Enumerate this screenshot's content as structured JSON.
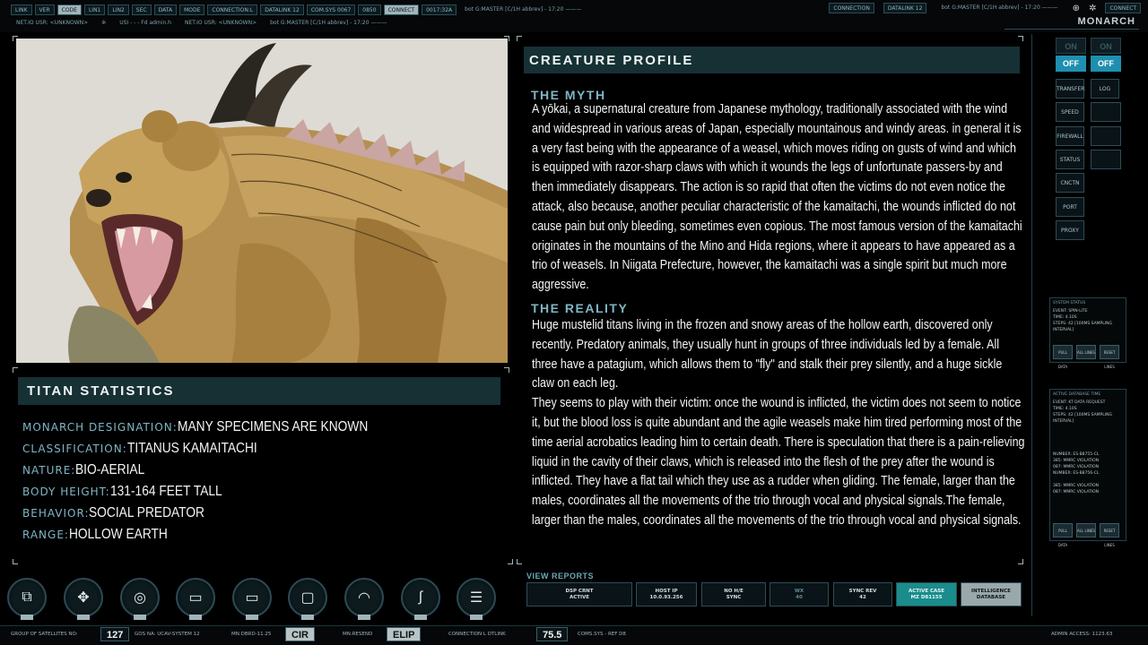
{
  "topbar": {
    "row1_buttons": [
      "LINK",
      "VER",
      "CODE",
      "LIN1",
      "LIN2",
      "SEC",
      "DATA",
      "MODE"
    ],
    "row1_texts": [
      "CONNECTION:L",
      "DATALINK 12",
      "COM.SYS 0067",
      "0850"
    ],
    "connect_label": "CONNECT",
    "code_readout": "0017:32A",
    "user_line": "bot G:MASTER [C/1H abbrev] - 17:20 ———",
    "row2_left": "NET.IO USR: <UNKNOWN>",
    "row2_mid": "USI - - - Fd admin.h",
    "row2_user": "NET.IO USR: <UNKNOWN>",
    "row2_bot": "bot G:MASTER [C/1H abbrev] - 17:20 ———",
    "right_connection": "CONNECTION",
    "right_datalink": "DATALINK 12",
    "right_user": "bot G:MASTER [C/1H abbrev] - 17:20 ———",
    "right_connect": "CONNECT",
    "brand": "MONARCH"
  },
  "stats": {
    "header": "TITAN STATISTICS",
    "rows": [
      {
        "label": "MONARCH DESIGNATION:",
        "value": "MANY SPECIMENS ARE KNOWN"
      },
      {
        "label": "CLASSIFICATION:",
        "value": "TITANUS KAMAITACHI"
      },
      {
        "label": "NATURE:",
        "value": "BIO-AERIAL"
      },
      {
        "label": "BODY HEIGHT:",
        "value": "131-164 FEET TALL"
      },
      {
        "label": "BEHAVIOR:",
        "value": "SOCIAL PREDATOR"
      },
      {
        "label": "RANGE:",
        "value": "HOLLOW EARTH"
      }
    ]
  },
  "profile": {
    "header": "CREATURE PROFILE",
    "myth_title": "THE MYTH",
    "myth_text": "A yōkai, a supernatural creature from Japanese mythology, traditionally associated with the wind and widespread in various areas of Japan, especially mountainous and windy areas. in general it is a very fast being with the appearance of a weasel, which moves riding on gusts of wind and which is equipped with razor-sharp claws with which it wounds the legs of unfortunate passers-by and then immediately disappears. The action is so rapid that often the victims do not even notice the attack, also because, another peculiar characteristic of the kamaitachi, the wounds inflicted do not cause pain but only bleeding, sometimes even copious. The most famous version of the kamaitachi originates in the mountains of the Mino and Hida regions, where it appears to have appeared as a trio of weasels. In Niigata Prefecture, however, the kamaitachi was a single spirit but much more aggressive.",
    "reality_title": "THE REALITY",
    "reality_text": "Huge mustelid titans living in the frozen and snowy areas of the hollow earth, discovered only recently. Predatory animals, they usually hunt in groups of three individuals led by a female. All three have a patagium, which allows them to \"fly\" and stalk their prey silently, and a huge sickle claw on each leg.\nThey seems to play with their victim: once the wound is inflicted, the victim does not seem to notice it, but the blood loss is quite abundant and the agile weasels make him tired performing most of the time aerial acrobatics leading him to certain death. There is speculation that there is a pain-relieving liquid in the cavity of their claws, which is released into the flesh of the prey after the wound is inflicted. They have a flat tail which they use as a rudder when gliding. The female, larger than the males, coordinates all the movements of the trio through vocal and physical signals.The female, larger than the males, coordinates all the movements of the trio through vocal and physical signals."
  },
  "sidebar": {
    "on_label": "ON",
    "off_label": "OFF",
    "buttons": [
      "TRANSFER",
      "SPEED",
      "FIREWALL",
      "STATUS",
      "CNCTN",
      "PORT",
      "PROXY"
    ],
    "log_label": "LOG",
    "panel1": {
      "title": "SYSTEM STATUS",
      "lines": [
        "EVENT:    SPIN-LITE",
        "TIME:     4.10S",
        "STEPS:    42 [100MS SAMPLING",
        "INTERVAL]"
      ],
      "buttons": [
        "PULL DATA",
        "ALL LINES",
        "RESET LINES"
      ]
    },
    "panel2": {
      "title": "ACTIVE DATABASE TIME",
      "lines": [
        "EVENT:    KT DATA REQUEST",
        "TIME:     4.10S",
        "STEPS:    42 [100MS SAMPLING",
        "INTERVAL]",
        "",
        "NUMBER:   ES-B8755-CL",
        "385:      MMRC VIOLATION",
        "087:      MMRC VIOLATION",
        "NUMBER:   ES-B8756-CL",
        "",
        "385:      MMRC VIOLATION",
        "087:      MMRC VIOLATION"
      ],
      "buttons": [
        "PULL DATA",
        "ALL LINES",
        "RESET LINES"
      ]
    }
  },
  "reports": {
    "title": "VIEW REPORTS",
    "buttons": [
      {
        "line1": "DSP CRNT",
        "line2": "ACTIVE"
      },
      {
        "line1": "HOST IP",
        "line2": "10.0.93.256"
      },
      {
        "line1": "NO H/E",
        "line2": "SYNC"
      },
      {
        "line1": "WX",
        "line2": "40"
      },
      {
        "line1": "SYNC REV",
        "line2": "42"
      },
      {
        "line1": "ACTIVE CASE",
        "line2": "MZ D81155"
      },
      {
        "line1": "INTELLIGENCE",
        "line2": "DATABASE"
      }
    ]
  },
  "statusbar": {
    "satellites_label": "GROUP OF SATELLITES NO:",
    "satellites_value": "127",
    "gos": "GOS NA: UCAV-SYSTEM 12",
    "mn_dbrd": "MN.DBRD-11.25",
    "cir": "CIR",
    "mn_resend": "MN.RESEND",
    "elip": "ELIP",
    "connection": "CONNECTION L DTLINK",
    "value": "75.5",
    "coms": "COMS.SYS - REF D8",
    "admin": "ADMIN ACCESS: 1123.63"
  },
  "colors": {
    "accent": "#7fb6c4",
    "header_bg": "#163034",
    "toggle_blue": "#1f8fb0",
    "teal_button": "#1a8c8c"
  }
}
